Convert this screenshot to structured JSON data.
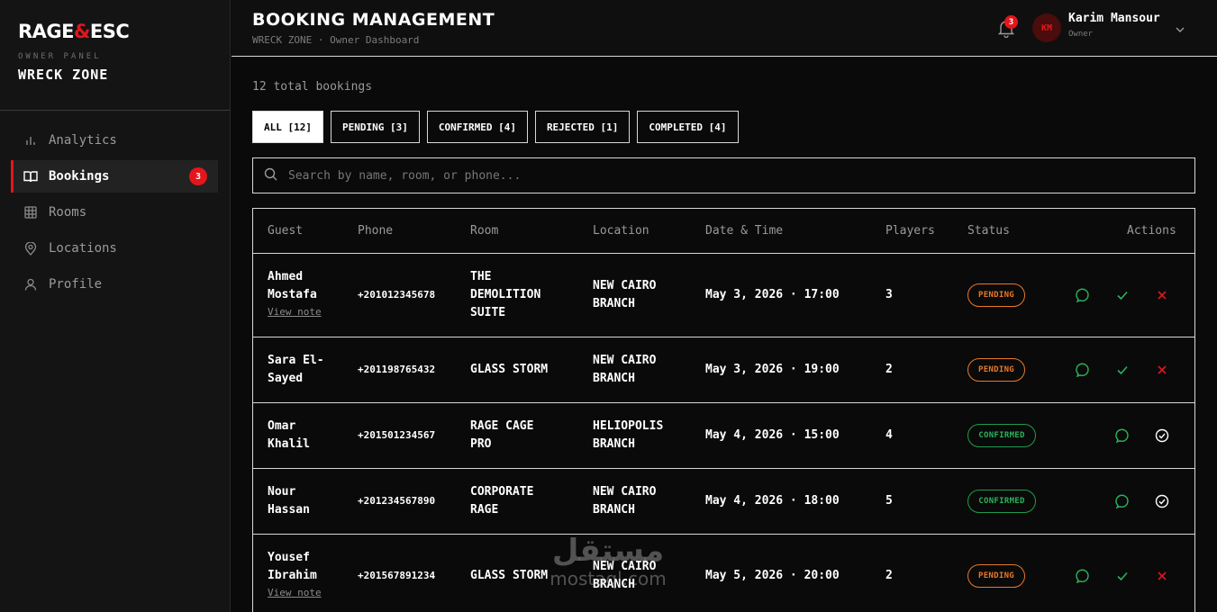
{
  "brand": {
    "logo_left": "RAGE",
    "logo_amp": "&",
    "logo_right": "ESC",
    "panel_label": "OWNER PANEL",
    "venue": "WRECK ZONE"
  },
  "nav": {
    "items": [
      {
        "label": "Analytics",
        "icon": "bar-chart-icon"
      },
      {
        "label": "Bookings",
        "icon": "book-icon",
        "badge": "3"
      },
      {
        "label": "Rooms",
        "icon": "grid-icon"
      },
      {
        "label": "Locations",
        "icon": "map-pin-icon"
      },
      {
        "label": "Profile",
        "icon": "user-icon"
      }
    ]
  },
  "header": {
    "title": "BOOKING MANAGEMENT",
    "breadcrumb": "WRECK ZONE · Owner Dashboard",
    "notification_count": "3",
    "user": {
      "initials": "KM",
      "name": "Karim Mansour",
      "role": "Owner"
    }
  },
  "summary": {
    "total": "12 total bookings"
  },
  "filters": [
    {
      "label": "ALL [12]",
      "active": true
    },
    {
      "label": "PENDING [3]"
    },
    {
      "label": "CONFIRMED [4]"
    },
    {
      "label": "REJECTED [1]"
    },
    {
      "label": "COMPLETED [4]"
    }
  ],
  "search": {
    "placeholder": "Search by name, room, or phone..."
  },
  "table": {
    "columns": [
      "Guest",
      "Phone",
      "Room",
      "Location",
      "Date & Time",
      "Players",
      "Status",
      "Actions"
    ],
    "rows": [
      {
        "guest_1": "Ahmed",
        "guest_2": "Mostafa",
        "note": "View note",
        "phone": "+201012345678",
        "room_1": "THE",
        "room_2": "DEMOLITION",
        "room_3": "SUITE",
        "loc_1": "NEW CAIRO",
        "loc_2": "BRANCH",
        "datetime": "May 3, 2026 · 17:00",
        "players": "3",
        "status": "PENDING"
      },
      {
        "guest_1": "Sara El-",
        "guest_2": "Sayed",
        "phone": "+201198765432",
        "room_1": "GLASS STORM",
        "loc_1": "NEW CAIRO",
        "loc_2": "BRANCH",
        "datetime": "May 3, 2026 · 19:00",
        "players": "2",
        "status": "PENDING"
      },
      {
        "guest_1": "Omar",
        "guest_2": "Khalil",
        "phone": "+201501234567",
        "room_1": "RAGE CAGE",
        "room_2": "PRO",
        "loc_1": "HELIOPOLIS",
        "loc_2": "BRANCH",
        "datetime": "May 4, 2026 · 15:00",
        "players": "4",
        "status": "CONFIRMED"
      },
      {
        "guest_1": "Nour",
        "guest_2": "Hassan",
        "phone": "+201234567890",
        "room_1": "CORPORATE",
        "room_2": "RAGE",
        "loc_1": "NEW CAIRO",
        "loc_2": "BRANCH",
        "datetime": "May 4, 2026 · 18:00",
        "players": "5",
        "status": "CONFIRMED"
      },
      {
        "guest_1": "Yousef",
        "guest_2": "Ibrahim",
        "note": "View note",
        "phone": "+201567891234",
        "room_1": "GLASS STORM",
        "loc_1": "NEW CAIRO",
        "loc_2": "BRANCH",
        "datetime": "May 5, 2026 · 20:00",
        "players": "2",
        "status": "PENDING"
      }
    ]
  },
  "watermark": {
    "arabic": "مستقل",
    "latin": "mostaql.com"
  },
  "colors": {
    "accent": "#e3161b",
    "pending": "#e8782a",
    "confirmed": "#2ab35a",
    "background": "#0a0a0a"
  }
}
